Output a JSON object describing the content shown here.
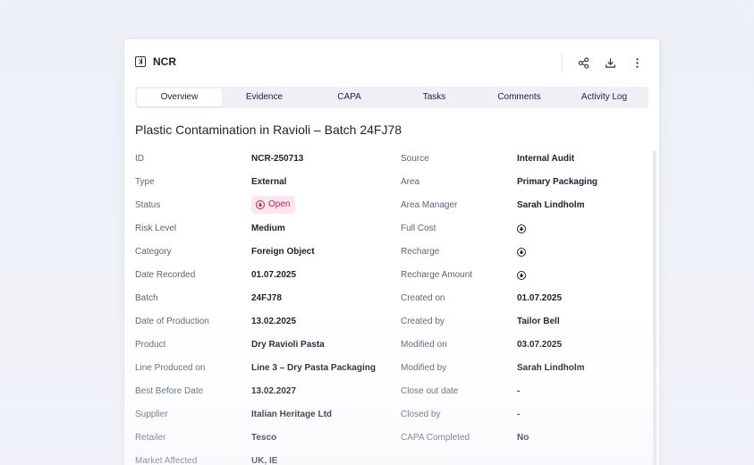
{
  "header": {
    "title": "NCR",
    "icons": [
      "panel-icon",
      "share-icon",
      "download-icon",
      "more-vertical-icon"
    ]
  },
  "tabs": [
    {
      "label": "Overview",
      "active": true
    },
    {
      "label": "Evidence",
      "active": false
    },
    {
      "label": "CAPA",
      "active": false
    },
    {
      "label": "Tasks",
      "active": false
    },
    {
      "label": "Comments",
      "active": false
    },
    {
      "label": "Activity Log",
      "active": false
    }
  ],
  "record": {
    "title": "Plastic Contamination in Ravioli – Batch 24FJ78"
  },
  "details": {
    "left": [
      {
        "label": "ID",
        "value": "NCR-250713"
      },
      {
        "label": "Type",
        "value": "External"
      },
      {
        "label": "Status",
        "value": "Open"
      },
      {
        "label": "Risk Level",
        "value": "Medium"
      },
      {
        "label": "Category",
        "value": "Foreign Object"
      },
      {
        "label": "Date Recorded",
        "value": "01.07.2025"
      },
      {
        "label": "Batch",
        "value": "24FJ78"
      },
      {
        "label": "Date of Production",
        "value": "13.02.2025"
      },
      {
        "label": "Product",
        "value": "Dry Ravioli Pasta"
      },
      {
        "label": "Line Produced on",
        "value": "Line 3 – Dry Pasta Packaging"
      },
      {
        "label": "Best Before Date",
        "value": "13.02.2027"
      },
      {
        "label": "Supplier",
        "value": "Italian Heritage Ltd"
      },
      {
        "label": "Retailer",
        "value": "Tesco"
      },
      {
        "label": "Market Affected",
        "value": "UK, IE"
      }
    ],
    "right": [
      {
        "label": "Source",
        "value": "Internal Audit"
      },
      {
        "label": "Area",
        "value": "Primary Packaging"
      },
      {
        "label": "Area Manager",
        "value": "Sarah Lindholm"
      },
      {
        "label": "Full Cost",
        "value": ""
      },
      {
        "label": "Recharge",
        "value": ""
      },
      {
        "label": "Recharge Amount",
        "value": ""
      },
      {
        "label": "Created on",
        "value": "01.07.2025"
      },
      {
        "label": "Created by",
        "value": "Tailor Bell"
      },
      {
        "label": "Modified on",
        "value": "03.07.2025"
      },
      {
        "label": "Modified by",
        "value": "Sarah Lindholm"
      },
      {
        "label": "Close out date",
        "value": "-"
      },
      {
        "label": "Closed by",
        "value": "-"
      },
      {
        "label": "CAPA Completed",
        "value": "No"
      }
    ]
  },
  "colors": {
    "status_open_bg": "#fde7ee",
    "status_open_text": "#c8234f",
    "label_text": "#5b6478",
    "value_text": "#1c2130",
    "tab_bar_bg": "#eef0f5"
  }
}
